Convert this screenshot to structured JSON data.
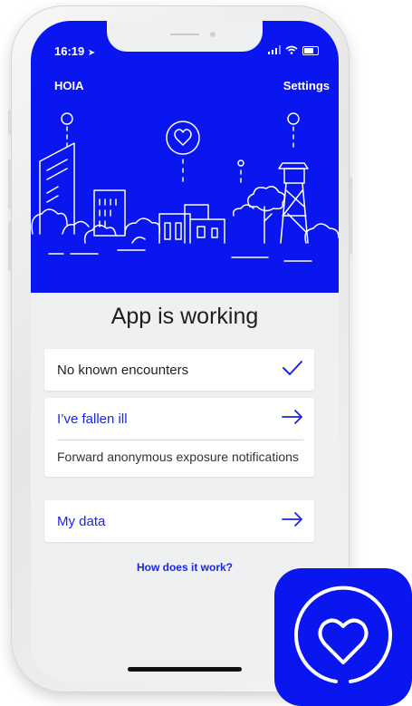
{
  "status_bar": {
    "time": "16:19",
    "signal": "····",
    "wifi": "•"
  },
  "header": {
    "app_name": "HOIA",
    "settings_label": "Settings"
  },
  "main": {
    "headline": "App is working",
    "encounters_text": "No known encounters",
    "fallen_ill_label": "I’ve fallen ill",
    "forward_text": "Forward anonymous exposure notifications",
    "my_data_label": "My data",
    "how_link": "How does it work?"
  },
  "colors": {
    "brand": "#0a16f0",
    "link": "#1a26e0"
  },
  "icons": [
    "location-arrow-icon",
    "signal-icon",
    "wifi-icon",
    "battery-icon",
    "check-icon",
    "arrow-right-icon",
    "heart-icon"
  ]
}
